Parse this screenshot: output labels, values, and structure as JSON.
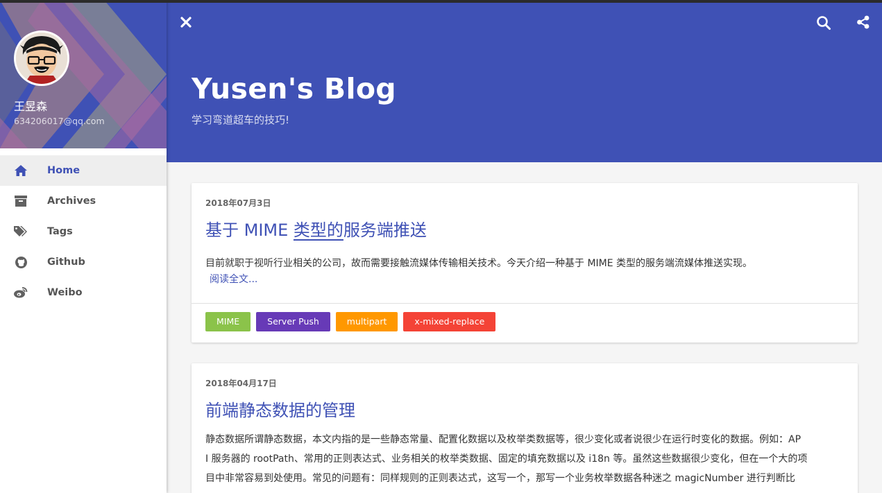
{
  "sidebar": {
    "user_name": "王昱森",
    "user_email": "634206017@qq.com",
    "items": [
      {
        "label": "Home",
        "icon": "home-icon"
      },
      {
        "label": "Archives",
        "icon": "archive-icon"
      },
      {
        "label": "Tags",
        "icon": "tags-icon"
      },
      {
        "label": "Github",
        "icon": "github-icon"
      },
      {
        "label": "Weibo",
        "icon": "weibo-icon"
      }
    ]
  },
  "header": {
    "title": "Yusen's Blog",
    "subtitle": "学习弯道超车的技巧!"
  },
  "posts": [
    {
      "date": "2018年07月3日",
      "title_pre": "基于 MIME ",
      "title_link": "类型的",
      "title_post": "服务端推送",
      "excerpt": "目前就职于视听行业相关的公司，故而需要接触流媒体传输相关技术。今天介绍一种基于 MIME 类型的服务端流媒体推送实现。",
      "read_more": "阅读全文...",
      "tags": [
        {
          "label": "MIME",
          "color": "#8bc34a"
        },
        {
          "label": "Server Push",
          "color": "#673ab7"
        },
        {
          "label": "multipart",
          "color": "#ff9800"
        },
        {
          "label": "x-mixed-replace",
          "color": "#f44336"
        }
      ]
    },
    {
      "date": "2018年04月17日",
      "title": "前端静态数据的管理",
      "excerpt_lines": [
        "静态数据所谓静态数据，本文内指的是一些静态常量、配置化数据以及枚举类数据等，很少变化或者说很少在运行时变化的数据。例如：AP",
        "I 服务器的 rootPath、常用的正则表达式、业务相关的枚举类数据、固定的填充数据以及 i18n 等。虽然这些数据很少变化，但在一个大的项",
        "目中非常容易到处使用。常见的问题有：同样规则的正则表达式，这写一个，那写一个业务枚举数据各种迷之 magicNumber 进行判断比"
      ]
    }
  ],
  "colors": {
    "primary": "#3f51b5",
    "sidebar_bg": "#ffffff",
    "page_bg": "#f5f5f5"
  }
}
